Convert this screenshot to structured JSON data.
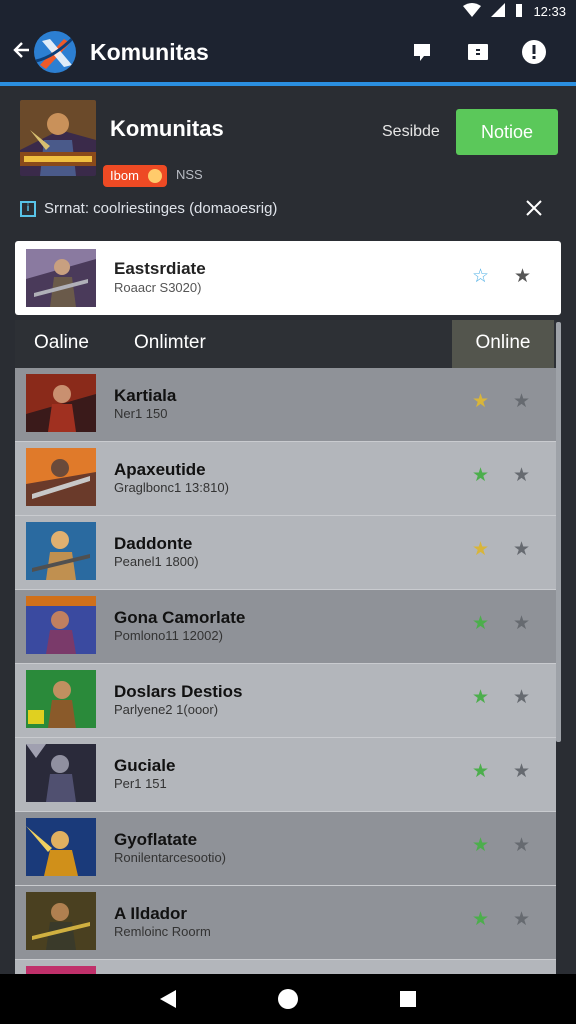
{
  "status_bar": {
    "time": "12:33"
  },
  "app_bar": {
    "title": "Komunitas"
  },
  "header": {
    "title": "Komunitas",
    "subtitle": "Sesibde",
    "notice_label": "Notioe",
    "badge_label": "Ibom",
    "badge_meta": "NSS",
    "hint_text": "Srrnat: coolriestinges (domaoesrig)"
  },
  "featured": {
    "name": "Eastsrdiate",
    "meta": "Roaacr S3020)"
  },
  "tabs": {
    "tab1": "Oaline",
    "tab2": "Onlimter",
    "active": "Online"
  },
  "rows": [
    {
      "name": "Kartiala",
      "meta": "Ner1 150"
    },
    {
      "name": "Apaxeutide",
      "meta": "Graglbonc1 13:810)"
    },
    {
      "name": "Daddonte",
      "meta": "Peanel1 1800)"
    },
    {
      "name": "Gona Camorlate",
      "meta": "Pomlono11 12002)"
    },
    {
      "name": "Doslars Destios",
      "meta": "Parlyene2 1(ooor)"
    },
    {
      "name": "Guciale",
      "meta": "Per1 151"
    },
    {
      "name": "Gyoflatate",
      "meta": "Ronilentarcesootio)"
    },
    {
      "name": "A Ildador",
      "meta": "Remloinc Roorm"
    }
  ],
  "colors": {
    "accent": "#2b8fe0",
    "notice_green": "#5bc85a",
    "badge_orange": "#ee4a24",
    "star_gold": "#d8b53a",
    "star_green": "#4cae4c",
    "star_grey": "#666a70"
  },
  "icons": {
    "back": "back-arrow-icon",
    "chat": "chat-bubble-icon",
    "message": "message-icon",
    "info": "info-icon",
    "star_outline": "star-outline-icon",
    "star": "star-icon",
    "close": "close-icon"
  }
}
